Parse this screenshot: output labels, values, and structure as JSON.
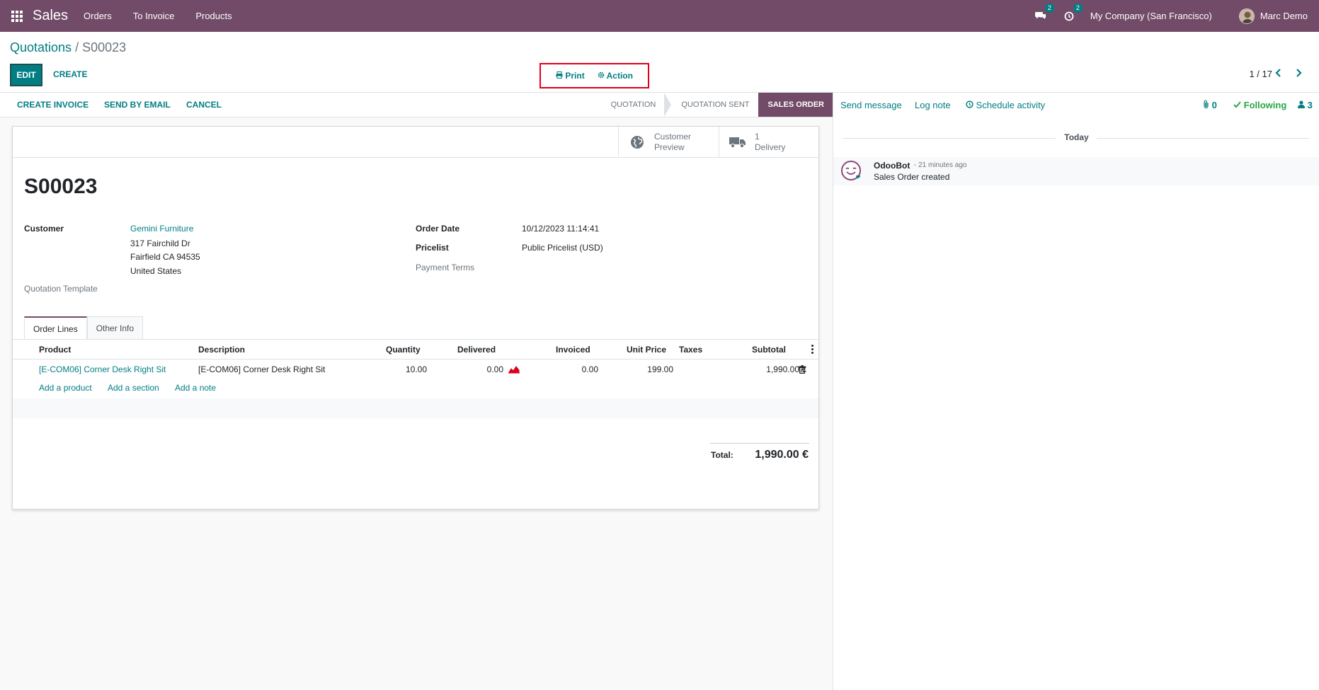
{
  "navbar": {
    "app_name": "Sales",
    "menu": [
      "Orders",
      "To Invoice",
      "Products"
    ],
    "messages_badge": "2",
    "activities_badge": "2",
    "company": "My Company (San Francisco)",
    "user": "Marc Demo"
  },
  "breadcrumb": {
    "parent": "Quotations",
    "separator": " / ",
    "current": "S00023"
  },
  "toolbar": {
    "edit_label": "EDIT",
    "create_label": "CREATE",
    "print_label": "Print",
    "action_label": "Action"
  },
  "pager": {
    "value": "1 / 17"
  },
  "statusbar": {
    "buttons": [
      "CREATE INVOICE",
      "SEND BY EMAIL",
      "CANCEL"
    ],
    "stages": [
      "QUOTATION",
      "QUOTATION SENT",
      "SALES ORDER"
    ],
    "active_stage": "SALES ORDER"
  },
  "smart_buttons": {
    "preview": {
      "line1": "Customer",
      "line2": "Preview"
    },
    "delivery": {
      "count": "1",
      "label": "Delivery"
    }
  },
  "form": {
    "title": "S00023",
    "customer_label": "Customer",
    "customer_name": "Gemini Furniture",
    "address_line1": "317 Fairchild Dr",
    "address_line2": "Fairfield CA 94535",
    "address_line3": "United States",
    "quotation_template_label": "Quotation Template",
    "order_date_label": "Order Date",
    "order_date": "10/12/2023 11:14:41",
    "pricelist_label": "Pricelist",
    "pricelist": "Public Pricelist (USD)",
    "payment_terms_label": "Payment Terms"
  },
  "tabs": [
    "Order Lines",
    "Other Info"
  ],
  "lines": {
    "headers": [
      "Product",
      "Description",
      "Quantity",
      "Delivered",
      "Invoiced",
      "Unit Price",
      "Taxes",
      "Subtotal"
    ],
    "rows": [
      {
        "product": "[E-COM06] Corner Desk Right Sit",
        "description": "[E-COM06] Corner Desk Right Sit",
        "quantity": "10.00",
        "delivered": "0.00",
        "invoiced": "0.00",
        "unit_price": "199.00",
        "taxes": "",
        "subtotal": "1,990.00 €"
      }
    ],
    "add_product": "Add a product",
    "add_section": "Add a section",
    "add_note": "Add a note"
  },
  "totals": {
    "label": "Total:",
    "value": "1,990.00 €"
  },
  "chatter": {
    "send_message": "Send message",
    "log_note": "Log note",
    "schedule_activity": "Schedule activity",
    "attachments_count": "0",
    "following_label": "Following",
    "followers_count": "3",
    "date_separator": "Today",
    "messages": [
      {
        "author": "OdooBot",
        "time": "- 21 minutes ago",
        "body": "Sales Order created"
      }
    ]
  },
  "colors": {
    "brand": "#714B67",
    "accent": "#017e84",
    "highlight_box": "#e0001a",
    "following": "#28a745"
  }
}
